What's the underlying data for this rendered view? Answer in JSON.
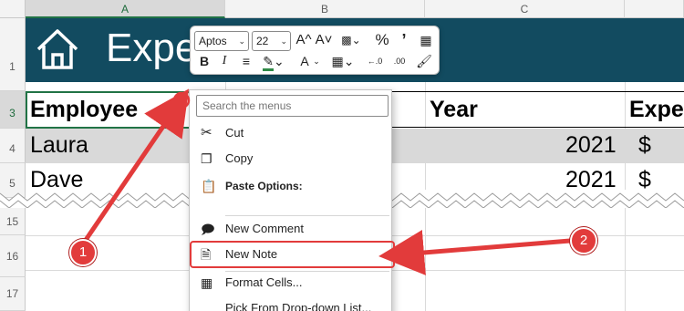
{
  "columns": [
    "A",
    "B",
    "C"
  ],
  "rows": [
    "1",
    "3",
    "4",
    "5",
    "15",
    "16",
    "17"
  ],
  "banner": {
    "title": "Expe"
  },
  "header_row": {
    "employee": "Employee",
    "year": "Year",
    "expense": "Expe"
  },
  "data_rows": [
    {
      "name": "Laura",
      "year": "2021",
      "currency": "$"
    },
    {
      "name": "Dave",
      "year": "2021",
      "currency": "$"
    }
  ],
  "mini_toolbar": {
    "font_name": "Aptos",
    "font_size": "22",
    "grow_font": "A^",
    "shrink_font": "A˅",
    "percent": "%",
    "comma": "༻",
    "bold": "B",
    "italic": "I",
    "font_color_letter": "A",
    "decrease_decimal": "←.0",
    "increase_decimal": ".00"
  },
  "context_menu": {
    "search_placeholder": "Search the menus",
    "items": {
      "cut": "Cut",
      "copy": "Copy",
      "paste_options": "Paste Options:",
      "new_comment": "New Comment",
      "new_note": "New Note",
      "format_cells": "Format Cells...",
      "pick_dropdown": "Pick From Drop-down List..."
    }
  },
  "annotations": {
    "badge_1": "1",
    "badge_2": "2"
  },
  "colors": {
    "banner": "#124b60",
    "accent_red": "#e23b3b",
    "select_green": "#217346"
  }
}
